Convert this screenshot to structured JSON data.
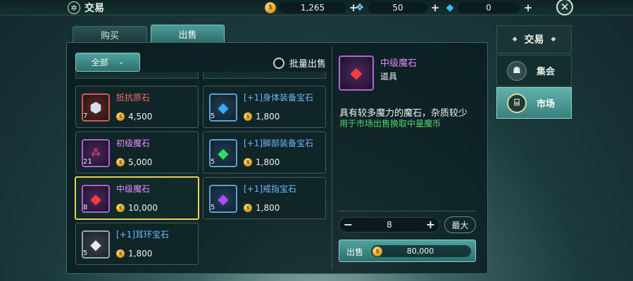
{
  "header": {
    "title_icon": "compass-icon",
    "title": "交易",
    "gold": "1,265",
    "gems_blue": "50",
    "diamonds": "0"
  },
  "tabs": [
    {
      "label": "购买",
      "active": false
    },
    {
      "label": "出售",
      "active": true
    }
  ],
  "filter": {
    "label": "全部"
  },
  "batch_sell": {
    "label": "批量出售",
    "checked": false
  },
  "items": [
    {
      "name": "抵抗原石",
      "qty": "7",
      "price": "4,500",
      "rarity": "red",
      "icon": "silver-stone-icon"
    },
    {
      "name": "[+1]身体装备宝石",
      "qty": "5",
      "price": "1,800",
      "rarity": "blue",
      "icon": "blue-gem-icon"
    },
    {
      "name": "初级魔石",
      "qty": "21",
      "price": "5,000",
      "rarity": "purple",
      "icon": "red-shards-icon"
    },
    {
      "name": "[+1]脚部装备宝石",
      "qty": "5",
      "price": "1,800",
      "rarity": "blue",
      "icon": "green-gem-icon"
    },
    {
      "name": "中级魔石",
      "qty": "8",
      "price": "10,000",
      "rarity": "purple",
      "icon": "red-crystal-icon",
      "selected": true
    },
    {
      "name": "[+1]戒指宝石",
      "qty": "5",
      "price": "1,800",
      "rarity": "blue",
      "icon": "purple-gem-icon"
    },
    {
      "name": "[+1]耳环宝石",
      "qty": "5",
      "price": "1,800",
      "rarity": "blue",
      "icon": "white-gem-icon"
    }
  ],
  "detail": {
    "name": "中级魔石",
    "type": "道具",
    "description": "具有较多魔力的魔石，杂质较少",
    "usage": "用于市场出售换取中量魔币",
    "quantity": "8",
    "max_label": "最大",
    "sell_label": "出售",
    "sell_amount": "80,000"
  },
  "sidebar": {
    "header": "交易",
    "items": [
      {
        "label": "集会",
        "icon": "bag-icon",
        "active": false
      },
      {
        "label": "市场",
        "icon": "stall-icon",
        "active": true
      }
    ]
  }
}
